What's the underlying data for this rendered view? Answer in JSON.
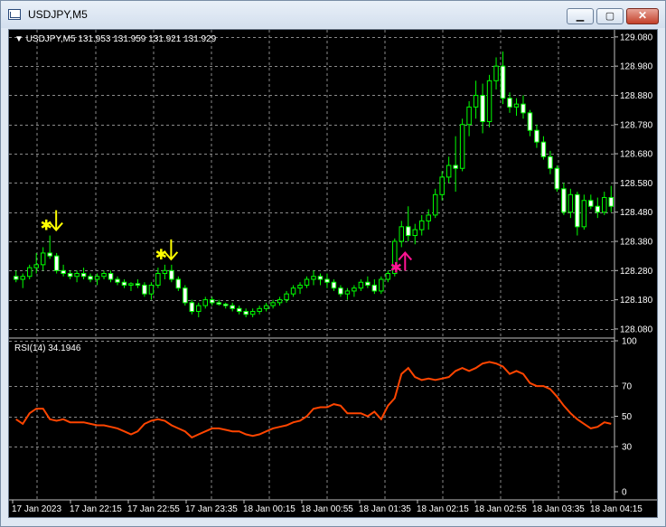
{
  "window": {
    "title": "USDJPY,M5",
    "controls": {
      "minimize": "▁",
      "maximize": "▢",
      "close": "✕"
    }
  },
  "price_panel": {
    "info_arrow": "▼",
    "info_text": "USDJPY,M5  131.953 131.959 131.921 131.929",
    "y_ticks": [
      "129.080",
      "128.980",
      "128.880",
      "128.780",
      "128.680",
      "128.580",
      "128.480",
      "128.380",
      "128.280",
      "128.180",
      "128.080"
    ],
    "markers": [
      {
        "type": "sell-arrow",
        "color": "#ffff00",
        "bar": 5
      },
      {
        "type": "sell-arrow",
        "color": "#ffff00",
        "bar": 22
      },
      {
        "type": "buy-arrow",
        "color": "#ff1493",
        "bar": 57
      }
    ]
  },
  "rsi_panel": {
    "label": "RSI(14) 34.1946",
    "y_ticks": [
      "100",
      "70",
      "50",
      "30",
      "0"
    ],
    "line_color": "#ff4500"
  },
  "time_axis": {
    "labels": [
      "17 Jan 2023",
      "17 Jan 22:15",
      "17 Jan 22:55",
      "17 Jan 23:35",
      "18 Jan 00:15",
      "18 Jan 00:55",
      "18 Jan 01:35",
      "18 Jan 02:15",
      "18 Jan 02:55",
      "18 Jan 03:35",
      "18 Jan 04:15"
    ]
  },
  "chart_data": [
    {
      "type": "candlestick",
      "symbol": "USDJPY",
      "timeframe": "M5",
      "ylim": [
        128.055,
        129.095
      ],
      "candles": [
        [
          128.26,
          128.28,
          128.24,
          128.25
        ],
        [
          128.25,
          128.27,
          128.22,
          128.26
        ],
        [
          128.26,
          128.3,
          128.25,
          128.29
        ],
        [
          128.29,
          128.34,
          128.27,
          128.3
        ],
        [
          128.3,
          128.36,
          128.28,
          128.34
        ],
        [
          128.34,
          128.4,
          128.32,
          128.33
        ],
        [
          128.33,
          128.34,
          128.27,
          128.28
        ],
        [
          128.28,
          128.3,
          128.26,
          128.27
        ],
        [
          128.27,
          128.28,
          128.25,
          128.26
        ],
        [
          128.26,
          128.28,
          128.24,
          128.27
        ],
        [
          128.27,
          128.29,
          128.25,
          128.26
        ],
        [
          128.26,
          128.27,
          128.24,
          128.25
        ],
        [
          128.25,
          128.27,
          128.23,
          128.26
        ],
        [
          128.26,
          128.28,
          128.25,
          128.27
        ],
        [
          128.27,
          128.28,
          128.24,
          128.25
        ],
        [
          128.25,
          128.26,
          128.23,
          128.24
        ],
        [
          128.24,
          128.25,
          128.22,
          128.23
        ],
        [
          128.23,
          128.24,
          128.21,
          128.235
        ],
        [
          128.235,
          128.25,
          128.22,
          128.23
        ],
        [
          128.23,
          128.24,
          128.19,
          128.2
        ],
        [
          128.2,
          128.24,
          128.18,
          128.23
        ],
        [
          128.23,
          128.29,
          128.22,
          128.27
        ],
        [
          128.27,
          128.3,
          128.25,
          128.28
        ],
        [
          128.28,
          128.3,
          128.24,
          128.25
        ],
        [
          128.25,
          128.26,
          128.21,
          128.22
        ],
        [
          128.22,
          128.23,
          128.16,
          128.17
        ],
        [
          128.17,
          128.18,
          128.13,
          128.14
        ],
        [
          128.14,
          128.17,
          128.12,
          128.16
        ],
        [
          128.16,
          128.19,
          128.15,
          128.18
        ],
        [
          128.18,
          128.19,
          128.16,
          128.17
        ],
        [
          128.17,
          128.18,
          128.16,
          128.165
        ],
        [
          128.165,
          128.17,
          128.15,
          128.16
        ],
        [
          128.16,
          128.17,
          128.14,
          128.15
        ],
        [
          128.15,
          128.16,
          128.13,
          128.14
        ],
        [
          128.14,
          128.15,
          128.12,
          128.13
        ],
        [
          128.13,
          128.15,
          128.12,
          128.14
        ],
        [
          128.14,
          128.16,
          128.13,
          128.15
        ],
        [
          128.15,
          128.17,
          128.14,
          128.16
        ],
        [
          128.16,
          128.18,
          128.15,
          128.17
        ],
        [
          128.17,
          128.19,
          128.16,
          128.18
        ],
        [
          128.18,
          128.21,
          128.17,
          128.2
        ],
        [
          128.2,
          128.23,
          128.19,
          128.22
        ],
        [
          128.22,
          128.24,
          128.2,
          128.23
        ],
        [
          128.23,
          128.26,
          128.22,
          128.25
        ],
        [
          128.25,
          128.28,
          128.23,
          128.26
        ],
        [
          128.26,
          128.27,
          128.23,
          128.25
        ],
        [
          128.25,
          128.27,
          128.22,
          128.24
        ],
        [
          128.24,
          128.25,
          128.21,
          128.22
        ],
        [
          128.22,
          128.23,
          128.19,
          128.2
        ],
        [
          128.2,
          128.22,
          128.18,
          128.21
        ],
        [
          128.21,
          128.23,
          128.19,
          128.22
        ],
        [
          128.22,
          128.25,
          128.21,
          128.24
        ],
        [
          128.24,
          128.26,
          128.22,
          128.23
        ],
        [
          128.23,
          128.25,
          128.2,
          128.21
        ],
        [
          128.21,
          128.26,
          128.2,
          128.25
        ],
        [
          128.25,
          128.28,
          128.24,
          128.27
        ],
        [
          128.27,
          128.39,
          128.26,
          128.38
        ],
        [
          128.38,
          128.45,
          128.36,
          128.43
        ],
        [
          128.43,
          128.5,
          128.38,
          128.4
        ],
        [
          128.4,
          128.44,
          128.37,
          128.42
        ],
        [
          128.42,
          128.47,
          128.4,
          128.45
        ],
        [
          128.45,
          128.49,
          128.42,
          128.47
        ],
        [
          128.47,
          128.56,
          128.46,
          128.54
        ],
        [
          128.54,
          128.62,
          128.52,
          128.6
        ],
        [
          128.6,
          128.67,
          128.58,
          128.64
        ],
        [
          128.64,
          128.74,
          128.55,
          128.63
        ],
        [
          128.63,
          128.8,
          128.62,
          128.78
        ],
        [
          128.78,
          128.86,
          128.74,
          128.84
        ],
        [
          128.84,
          128.93,
          128.8,
          128.88
        ],
        [
          128.88,
          128.92,
          128.75,
          128.79
        ],
        [
          128.79,
          128.95,
          128.77,
          128.93
        ],
        [
          128.93,
          129.01,
          128.9,
          128.98
        ],
        [
          128.98,
          129.03,
          128.85,
          128.87
        ],
        [
          128.87,
          128.89,
          128.82,
          128.84
        ],
        [
          128.84,
          128.87,
          128.81,
          128.85
        ],
        [
          128.85,
          128.88,
          128.8,
          128.82
        ],
        [
          128.82,
          128.83,
          128.74,
          128.76
        ],
        [
          128.76,
          128.78,
          128.7,
          128.72
        ],
        [
          128.72,
          128.74,
          128.66,
          128.67
        ],
        [
          128.67,
          128.69,
          128.61,
          128.63
        ],
        [
          128.63,
          128.64,
          128.55,
          128.56
        ],
        [
          128.56,
          128.58,
          128.47,
          128.48
        ],
        [
          128.48,
          128.56,
          128.46,
          128.54
        ],
        [
          128.54,
          128.55,
          128.4,
          128.43
        ],
        [
          128.43,
          128.54,
          128.42,
          128.52
        ],
        [
          128.52,
          128.54,
          128.49,
          128.5
        ],
        [
          128.5,
          128.53,
          128.46,
          128.48
        ],
        [
          128.48,
          128.55,
          128.47,
          128.53
        ],
        [
          128.53,
          128.57,
          128.48,
          128.5
        ]
      ]
    },
    {
      "type": "line",
      "name": "RSI(14)",
      "ylim": [
        0,
        100
      ],
      "values": [
        48,
        45,
        52,
        55,
        55,
        48,
        47,
        48,
        46,
        46,
        46,
        45,
        44,
        44,
        43,
        42,
        40,
        38,
        40,
        45,
        47,
        48,
        47,
        44,
        42,
        40,
        36,
        38,
        40,
        42,
        42,
        41,
        40,
        40,
        38,
        37,
        38,
        40,
        42,
        43,
        44,
        46,
        47,
        50,
        55,
        56,
        56,
        58,
        57,
        52,
        52,
        52,
        50,
        53,
        48,
        57,
        62,
        78,
        82,
        76,
        74,
        75,
        74,
        75,
        76,
        80,
        82,
        80,
        82,
        85,
        86,
        85,
        83,
        78,
        80,
        78,
        72,
        70,
        70,
        68,
        63,
        57,
        52,
        48,
        45,
        42,
        43,
        46,
        45
      ]
    }
  ]
}
